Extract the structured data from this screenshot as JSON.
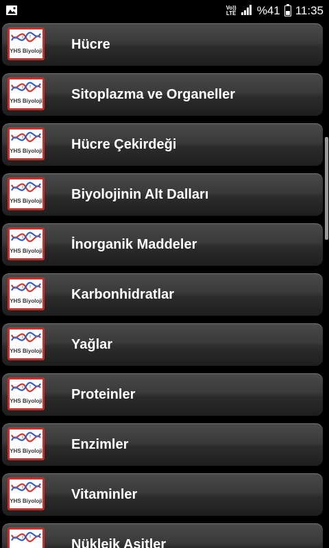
{
  "status_bar": {
    "volte_top": "Vo))",
    "volte_bottom": "LTE",
    "battery_text": "%41",
    "battery_level": 0.41,
    "time": "11:35"
  },
  "list": {
    "thumb_text": "YHS Biyoloji",
    "items": [
      {
        "label": "Hücre"
      },
      {
        "label": "Sitoplazma ve Organeller"
      },
      {
        "label": "Hücre Çekirdeği"
      },
      {
        "label": "Biyolojinin Alt Dalları"
      },
      {
        "label": "İnorganik Maddeler"
      },
      {
        "label": "Karbonhidratlar"
      },
      {
        "label": "Yağlar"
      },
      {
        "label": "Proteinler"
      },
      {
        "label": "Enzimler"
      },
      {
        "label": "Vitaminler"
      },
      {
        "label": "Nükleik Asitler"
      }
    ]
  },
  "colors": {
    "thumb_border": "#c9302c",
    "dna_red": "#d9342b",
    "dna_blue": "#2f5fc4"
  }
}
